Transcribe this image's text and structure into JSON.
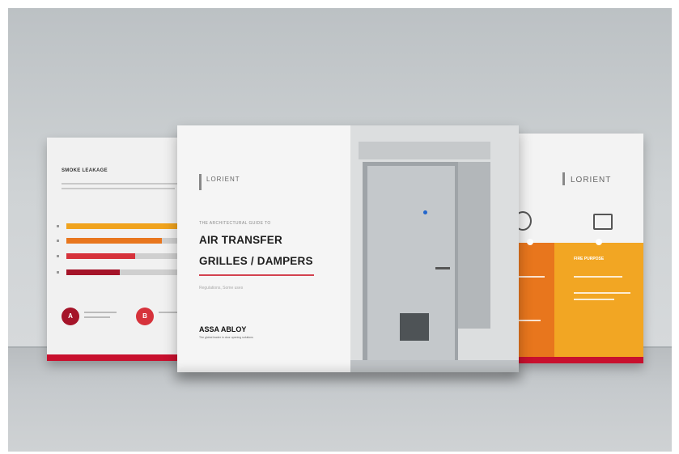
{
  "left_brochure": {
    "title": "SMOKE LEAKAGE",
    "circle_a": "A",
    "circle_b": "B",
    "bars": [
      {
        "fill": 0.95,
        "color": "#f0a31e"
      },
      {
        "fill": 0.72,
        "color": "#e8761d"
      },
      {
        "fill": 0.52,
        "color": "#d6323b"
      },
      {
        "fill": 0.4,
        "color": "#a51429"
      }
    ]
  },
  "center_brochure": {
    "logo": "LORIENT",
    "supertitle": "THE ARCHITECTURAL GUIDE TO",
    "title_line1": "AIR TRANSFER",
    "title_line2": "GRILLES / DAMPERS",
    "subtitle": "Regulations, Some uses",
    "brand": "ASSA ABLOY",
    "tagline": "The global leader in door opening solutions"
  },
  "right_brochure": {
    "logo": "LORIENT",
    "col2_head": "FIRE PURPOSE"
  }
}
